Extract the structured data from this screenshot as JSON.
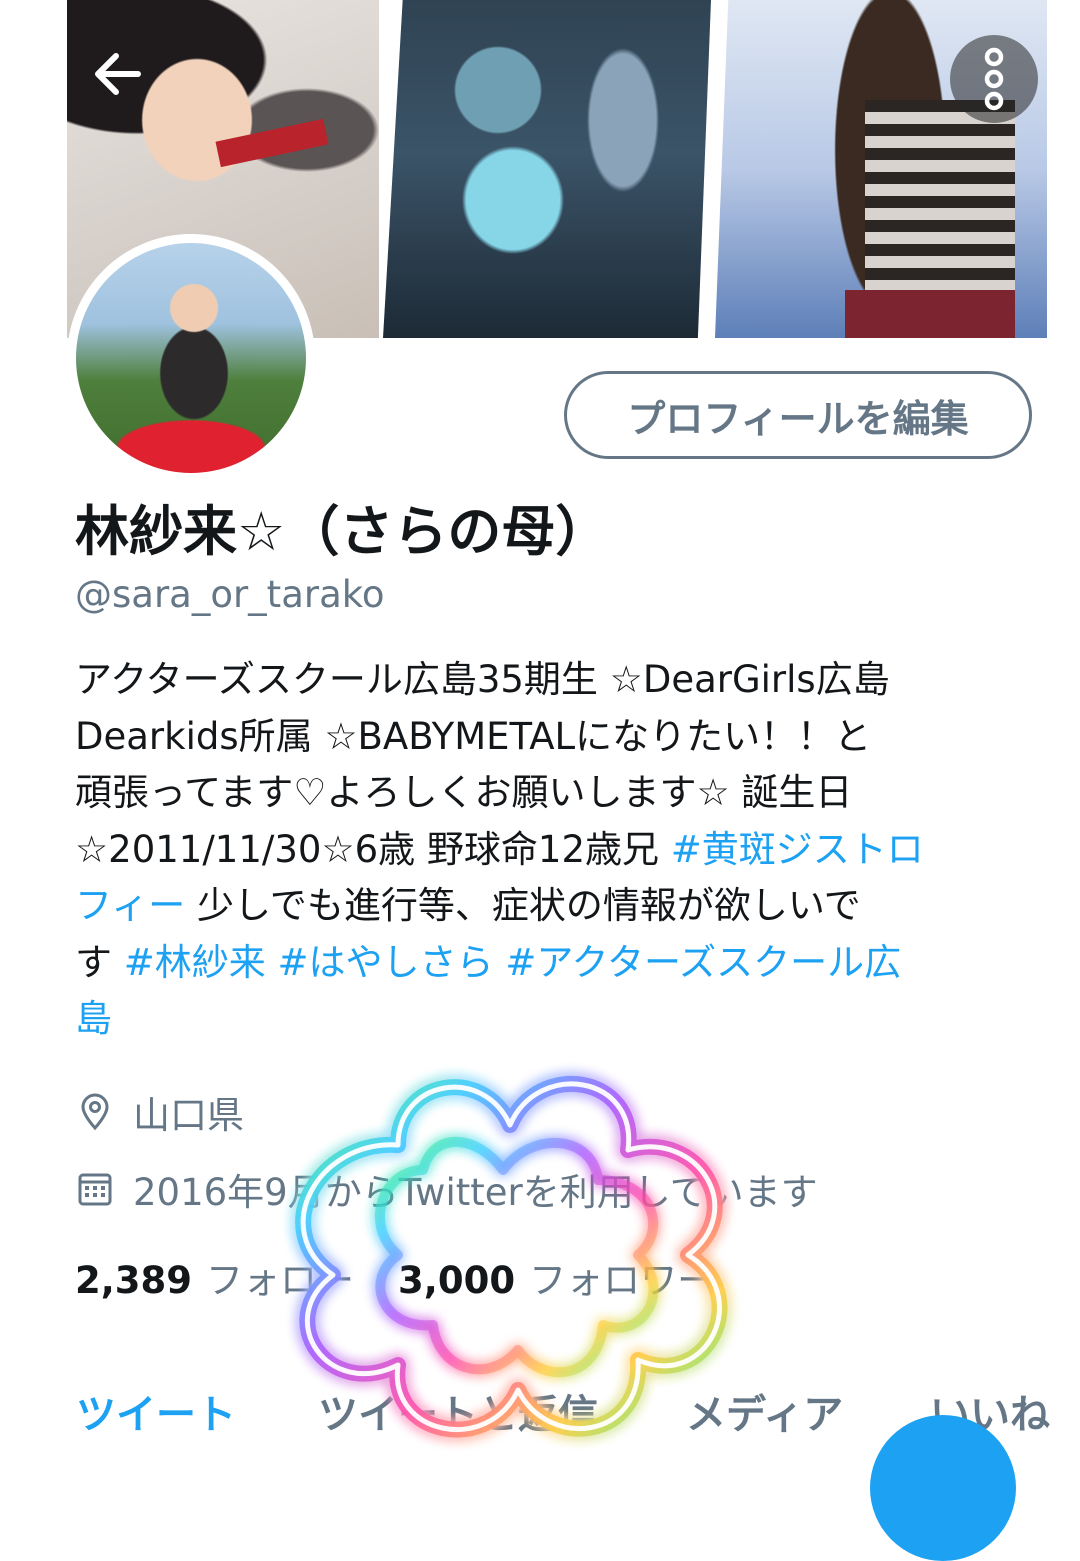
{
  "header": {
    "back_icon": "arrow-left-icon",
    "more_icon": "vertical-dots-icon"
  },
  "profile": {
    "edit_button": "プロフィールを編集",
    "name": "林紗来☆（さらの母）",
    "handle": "@sara_or_tarako",
    "bio_lines": [
      [
        {
          "t": "アクターズスクール広島35期生 ☆DearGirls広島"
        }
      ],
      [
        {
          "t": "Dearkids所属 ☆BABYMETALになりたい！！と"
        }
      ],
      [
        {
          "t": "頑張ってます♡よろしくお願いします☆ 誕生日"
        }
      ],
      [
        {
          "t": "☆2011/11/30☆6歳 野球命12歳兄 "
        },
        {
          "t": "#黄斑ジストロ",
          "tag": true
        }
      ],
      [
        {
          "t": "フィー",
          "tag": true
        },
        {
          "t": "  少しでも進行等、症状の情報が欲しいで"
        }
      ],
      [
        {
          "t": "す "
        },
        {
          "t": "#林紗来",
          "tag": true
        },
        {
          "t": "  "
        },
        {
          "t": "#はやしさら",
          "tag": true
        },
        {
          "t": "  "
        },
        {
          "t": "#アクターズスクール広",
          "tag": true
        }
      ],
      [
        {
          "t": "島",
          "tag": true
        }
      ]
    ],
    "location": "山口県",
    "location_icon": "location-pin-icon",
    "joined": "2016年9月からTwitterを利用しています",
    "joined_icon": "calendar-icon",
    "following_count": "2,389",
    "following_label": "フォロー",
    "followers_count": "3,000",
    "followers_label": "フォロワー"
  },
  "tabs": [
    {
      "label": "ツイート",
      "active": true
    },
    {
      "label": "ツイートと返信",
      "active": false
    },
    {
      "label": "メディア",
      "active": false
    },
    {
      "label": "いいね",
      "active": false
    }
  ],
  "colors": {
    "accent": "#1da1f2",
    "secondary_text": "#657786",
    "primary_text": "#14171a"
  }
}
